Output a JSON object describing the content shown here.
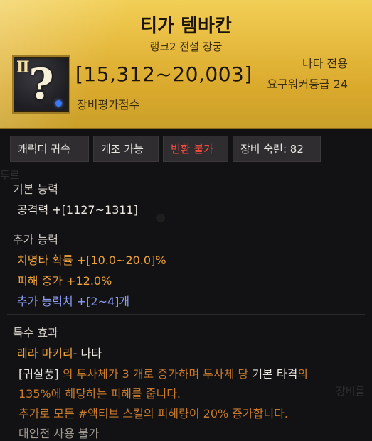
{
  "item": {
    "name": "티가 템바칸",
    "subtitle": "랭크2 전설 장궁",
    "tier": "II",
    "damage": "[15,312~20,003]",
    "score_label": "장비평가점수",
    "class_only": "나타 전용",
    "required_level": "요구워커등급 24"
  },
  "tags": [
    {
      "label": "캐릭터 귀속"
    },
    {
      "label": "개조 가능"
    },
    {
      "label": "변환 불가"
    },
    {
      "label": "장비 숙련: 82"
    }
  ],
  "basic": {
    "title": "기본 능력",
    "attack": "공격력  +[1127~1311]"
  },
  "extra": {
    "title": "추가 능력",
    "crit": "치명타 확률  +[10.0~20.0]%",
    "dmg_inc": "피해 증가  +12.0%",
    "extra_stat": "추가 능력치 +[2~4]개"
  },
  "special": {
    "title": "특수 효과",
    "name": "레라 마키리",
    "owner": "- 나타",
    "skill_tag": "[귀살풍]",
    "desc1_a": " 의 투사체가 3 개로 증가하며 투사체 당 ",
    "desc1_b": "기본 타격",
    "desc1_c": "의",
    "desc2": "135%에 해당하는 피해를 줍니다.",
    "desc3": "추가로 모든 #액티브 스킬의 피해량이 20% 증가합니다.",
    "pvp": "대인전 사용 불가"
  },
  "ghost": {
    "left": "투르",
    "right": "장비를"
  },
  "colors": {
    "header_gold": "#e6bb3f",
    "orange": "#f0a43a",
    "blue": "#8c9cf2",
    "red": "#ff4a3d"
  }
}
